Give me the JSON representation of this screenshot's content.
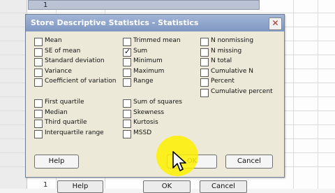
{
  "background": {
    "row_numbers": [
      "1",
      "1"
    ],
    "buttons": {
      "help": "Help",
      "ok": "OK",
      "cancel": "Cancel"
    }
  },
  "dialog": {
    "title": "Store Descriptive Statistics - Statistics",
    "close_glyph": "✕",
    "check_glyph": "✓",
    "columns": [
      [
        {
          "label": "Mean",
          "checked": false
        },
        {
          "label": "SE of mean",
          "checked": false
        },
        {
          "label": "Standard deviation",
          "checked": false
        },
        {
          "label": "Variance",
          "checked": false
        },
        {
          "label": "Coefficient of variation",
          "checked": false
        }
      ],
      [
        {
          "label": "First quartile",
          "checked": false
        },
        {
          "label": "Median",
          "checked": false
        },
        {
          "label": "Third quartile",
          "checked": false
        },
        {
          "label": "Interquartile range",
          "checked": false
        }
      ],
      [
        {
          "label": "Trimmed mean",
          "checked": false
        },
        {
          "label": "Sum",
          "checked": true
        },
        {
          "label": "Minimum",
          "checked": false
        },
        {
          "label": "Maximum",
          "checked": false
        },
        {
          "label": "Range",
          "checked": false
        }
      ],
      [
        {
          "label": "Sum of squares",
          "checked": false
        },
        {
          "label": "Skewness",
          "checked": false
        },
        {
          "label": "Kurtosis",
          "checked": false
        },
        {
          "label": "MSSD",
          "checked": false
        }
      ],
      [
        {
          "label": "N nonmissing",
          "checked": false
        },
        {
          "label": "N missing",
          "checked": false
        },
        {
          "label": "N total",
          "checked": false
        },
        {
          "label": "Cumulative N",
          "checked": false
        },
        {
          "label": "Percent",
          "checked": false
        },
        {
          "label": "Cumulative percent",
          "checked": false
        }
      ]
    ],
    "buttons": {
      "help": "Help",
      "ok": "OK",
      "cancel": "Cancel"
    }
  },
  "cursor": {
    "icon": "pointer-cursor-icon",
    "highlight_color": "#fff000"
  }
}
